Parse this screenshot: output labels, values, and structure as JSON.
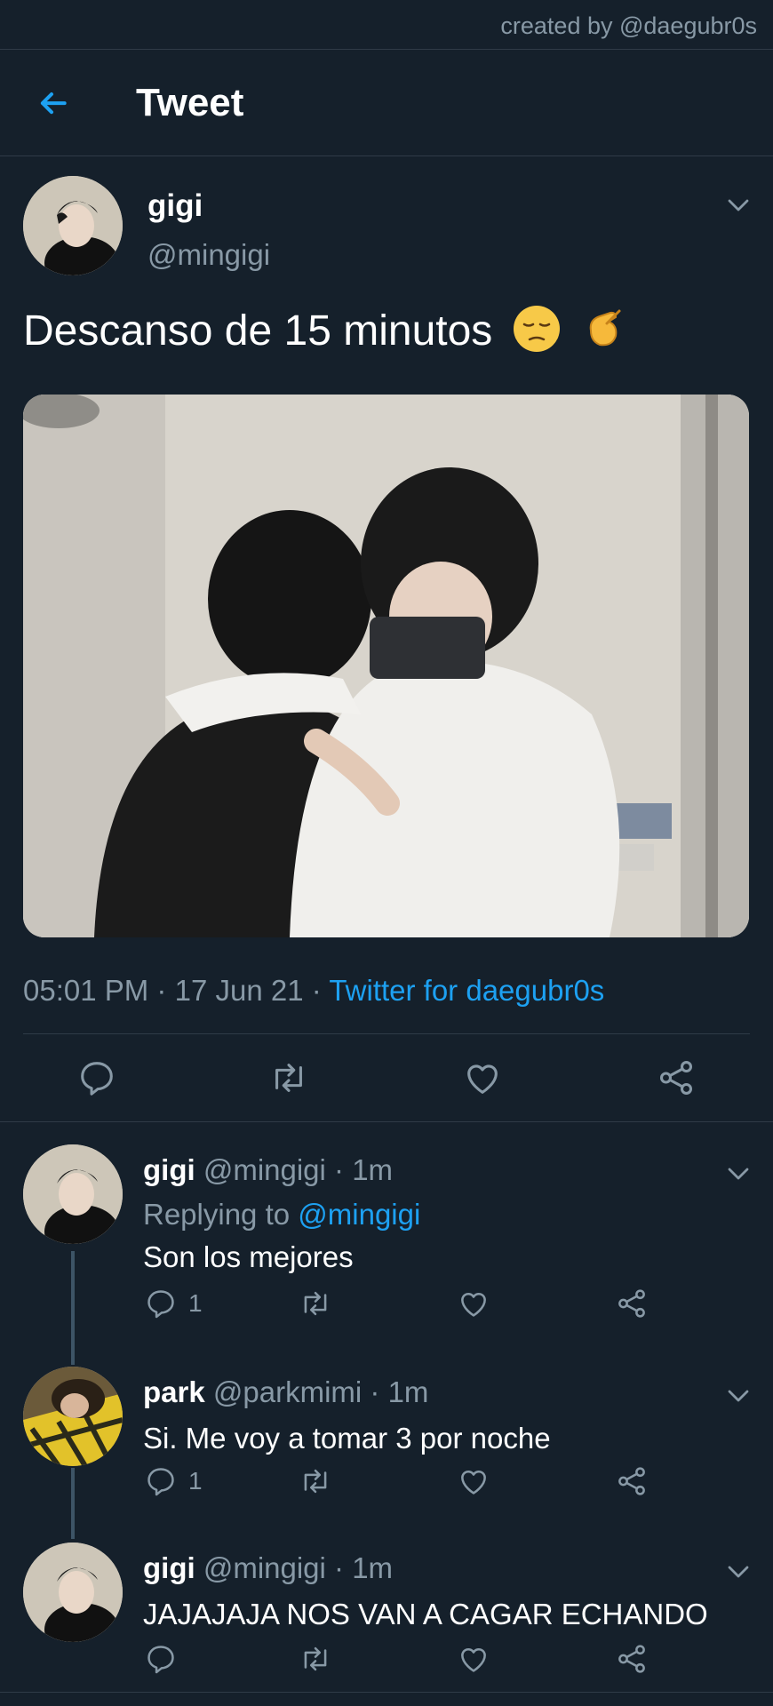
{
  "credit": "created by @daegubr0s",
  "header": {
    "title": "Tweet"
  },
  "tweet": {
    "name": "gigi",
    "handle": "@mingigi",
    "text": "Descanso de 15 minutos",
    "emojis": [
      "pensive-face",
      "pinching-hand"
    ],
    "time": "05:01 PM",
    "date": "17 Jun 21",
    "source": "Twitter for daegubr0s",
    "sep": "·"
  },
  "replies": [
    {
      "name": "gigi",
      "handle": "@mingigi",
      "age": "· 1m",
      "replying_label": "Replying to",
      "replying_to": "@mingigi",
      "text": "Son los mejores",
      "reply_count": "1"
    },
    {
      "name": "park",
      "handle": "@parkmimi",
      "age": "· 1m",
      "text": "Si. Me voy a tomar 3 por noche",
      "reply_count": "1"
    },
    {
      "name": "gigi",
      "handle": "@mingigi",
      "age": "· 1m",
      "text": "JAJAJAJA NOS VAN A CAGAR ECHANDO",
      "reply_count": ""
    }
  ],
  "colors": {
    "background": "#15202b",
    "accent": "#1da1f2",
    "muted": "#8899a6",
    "divider": "#2f3b47"
  },
  "icons": [
    "back-arrow-icon",
    "chevron-down-icon",
    "reply-icon",
    "retweet-icon",
    "like-icon",
    "share-icon"
  ]
}
